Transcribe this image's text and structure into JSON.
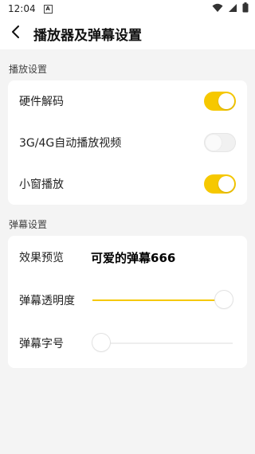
{
  "status_bar": {
    "time": "12:04",
    "notification_icon": "A"
  },
  "header": {
    "title": "播放器及弹幕设置"
  },
  "player_section": {
    "label": "播放设置",
    "items": [
      {
        "label": "硬件解码",
        "on": true
      },
      {
        "label": "3G/4G自动播放视频",
        "on": false
      },
      {
        "label": "小窗播放",
        "on": true
      }
    ]
  },
  "danmaku_section": {
    "label": "弹幕设置",
    "preview_label": "效果预览",
    "preview_text": "可爱的弹幕666",
    "opacity_label": "弹幕透明度",
    "opacity_value": 1.0,
    "font_size_label": "弹幕字号",
    "font_size_value": 0.0
  },
  "colors": {
    "accent": "#f6c800",
    "background": "#f4f4f4",
    "card": "#ffffff"
  }
}
